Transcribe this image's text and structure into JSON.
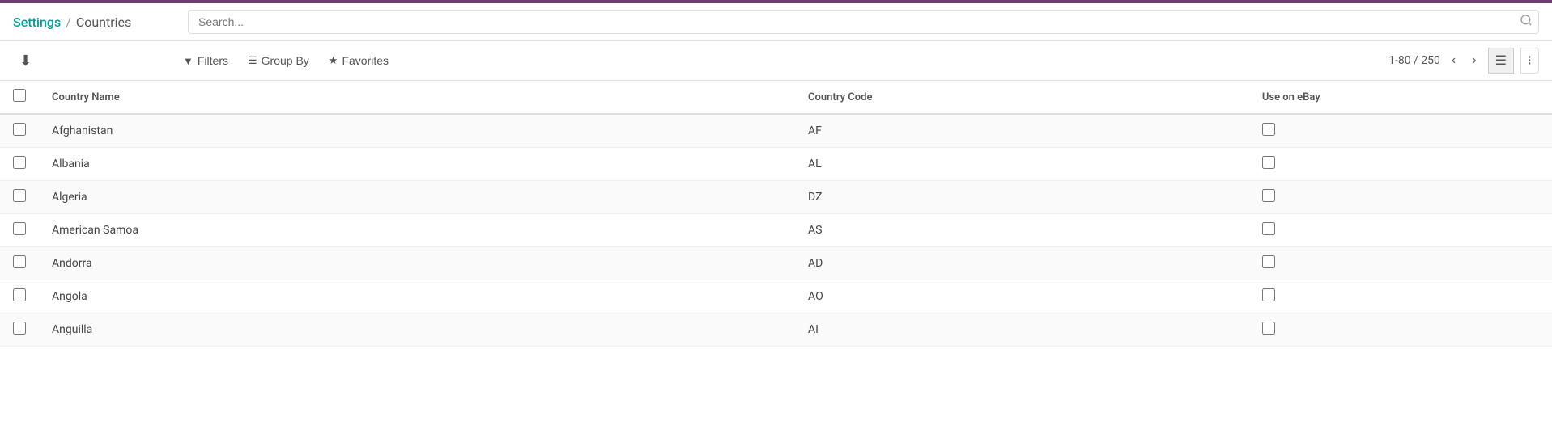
{
  "topbar": {
    "accent_color": "#6c3d6e"
  },
  "breadcrumb": {
    "link_text": "Settings",
    "separator": "/",
    "current": "Countries"
  },
  "search": {
    "placeholder": "Search..."
  },
  "toolbar": {
    "download_icon": "⬇",
    "filters_label": "Filters",
    "group_by_label": "Group By",
    "favorites_label": "Favorites",
    "pagination": "1-80 / 250",
    "list_view_icon": "≡",
    "grid_view_icon": "⊞"
  },
  "table": {
    "columns": [
      {
        "key": "checkbox",
        "label": ""
      },
      {
        "key": "name",
        "label": "Country Name"
      },
      {
        "key": "code",
        "label": "Country Code"
      },
      {
        "key": "ebay",
        "label": "Use on eBay"
      }
    ],
    "rows": [
      {
        "name": "Afghanistan",
        "code": "AF"
      },
      {
        "name": "Albania",
        "code": "AL"
      },
      {
        "name": "Algeria",
        "code": "DZ"
      },
      {
        "name": "American Samoa",
        "code": "AS"
      },
      {
        "name": "Andorra",
        "code": "AD"
      },
      {
        "name": "Angola",
        "code": "AO"
      },
      {
        "name": "Anguilla",
        "code": "AI"
      }
    ]
  }
}
